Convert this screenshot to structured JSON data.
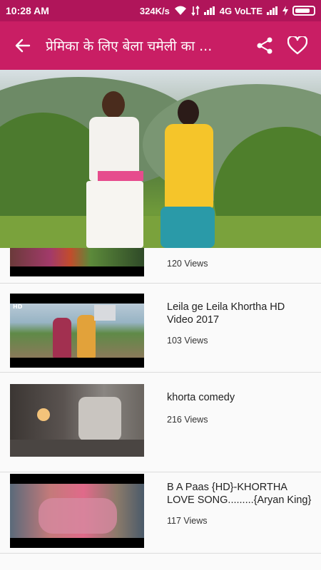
{
  "status": {
    "time": "10:28 AM",
    "speed": "324K/s",
    "network": "4G VoLTE"
  },
  "appbar": {
    "title": "प्रेमिका के लिए बेला चमेली का ...",
    "back_icon": "arrow-back-icon",
    "share_icon": "share-icon",
    "favorite_icon": "heart-outline-icon"
  },
  "videos": [
    {
      "title": "",
      "views": "120 Views"
    },
    {
      "title": "Leila ge Leila  Khortha HD Video 2017",
      "views": "103 Views",
      "badge": "HD"
    },
    {
      "title": "khorta comedy",
      "views": "216 Views"
    },
    {
      "title": "B A Paas {HD}-KHORTHA LOVE SONG.........{Aryan King}",
      "views": "117 Views"
    }
  ]
}
